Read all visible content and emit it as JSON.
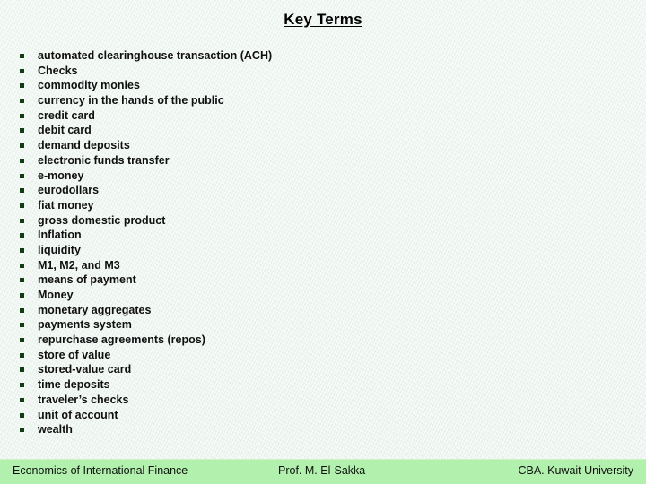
{
  "slide": {
    "title": "Key Terms",
    "background_color": "#eef5f1",
    "bullet_color": "#123d12"
  },
  "terms": [
    {
      "label": "automated clearinghouse transaction (ACH)"
    },
    {
      "label": "Checks"
    },
    {
      "label": "commodity monies"
    },
    {
      "label": "currency in the hands of the public"
    },
    {
      "label": "credit card"
    },
    {
      "label": "debit card"
    },
    {
      "label": "demand deposits"
    },
    {
      "label": "electronic funds transfer"
    },
    {
      "label": "e-money"
    },
    {
      "label": "eurodollars"
    },
    {
      "label": "fiat money"
    },
    {
      "label": "gross domestic product"
    },
    {
      "label": "Inflation"
    },
    {
      "label": "liquidity"
    },
    {
      "label": "M1, M2, and M3"
    },
    {
      "label": "means of payment"
    },
    {
      "label": "Money"
    },
    {
      "label": "monetary aggregates"
    },
    {
      "label": "payments system"
    },
    {
      "label": "repurchase agreements (repos)"
    },
    {
      "label": "store of value"
    },
    {
      "label": "stored-value card"
    },
    {
      "label": "time deposits"
    },
    {
      "label": "traveler’s checks"
    },
    {
      "label": "unit of account"
    },
    {
      "label": "wealth"
    }
  ],
  "footer": {
    "left": "Economics of International Finance",
    "center": "Prof. M. El-Sakka",
    "right": "CBA. Kuwait University",
    "background_color": "#b2f0ad"
  }
}
